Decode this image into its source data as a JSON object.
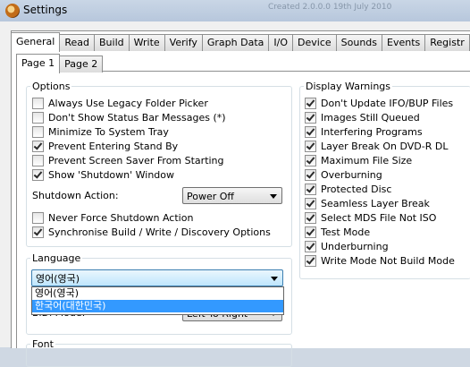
{
  "window": {
    "title": "Settings"
  },
  "tabs": [
    "General",
    "Read",
    "Build",
    "Write",
    "Verify",
    "Graph Data",
    "I/O",
    "Device",
    "Sounds",
    "Events",
    "Registr"
  ],
  "subtabs": [
    "Page 1",
    "Page 2"
  ],
  "options": {
    "legend": "Options",
    "items": [
      {
        "label": "Always Use Legacy Folder Picker",
        "checked": false
      },
      {
        "label": "Don't Show Status Bar Messages (*)",
        "checked": false
      },
      {
        "label": "Minimize To System Tray",
        "checked": false
      },
      {
        "label": "Prevent Entering Stand By",
        "checked": true
      },
      {
        "label": "Prevent Screen Saver From Starting",
        "checked": false
      },
      {
        "label": "Show 'Shutdown' Window",
        "checked": true
      }
    ],
    "shutdown_label": "Shutdown Action:",
    "shutdown_value": "Power Off",
    "items2": [
      {
        "label": "Never Force Shutdown Action",
        "checked": false
      },
      {
        "label": "Synchronise Build / Write / Discovery Options",
        "checked": true
      }
    ]
  },
  "display_warnings": {
    "legend": "Display Warnings",
    "items": [
      {
        "label": "Don't Update IFO/BUP Files",
        "checked": true
      },
      {
        "label": "Images Still Queued",
        "checked": true
      },
      {
        "label": "Interfering Programs",
        "checked": true
      },
      {
        "label": "Layer Break On DVD-R DL",
        "checked": true
      },
      {
        "label": "Maximum File Size",
        "checked": true
      },
      {
        "label": "Overburning",
        "checked": true
      },
      {
        "label": "Protected Disc",
        "checked": true
      },
      {
        "label": "Seamless Layer Break",
        "checked": true
      },
      {
        "label": "Select MDS File Not ISO",
        "checked": true
      },
      {
        "label": "Test Mode",
        "checked": true
      },
      {
        "label": "Underburning",
        "checked": true
      },
      {
        "label": "Write Mode Not Build Mode",
        "checked": true
      }
    ]
  },
  "language": {
    "legend": "Language",
    "selected": "영어(영국)",
    "options": [
      "영어(영국)",
      "한국어(대한민국)"
    ],
    "highlighted_index": 1,
    "bidi_label": "BiDi Mode:",
    "bidi_value": "Left To Right"
  },
  "font": {
    "legend": "Font"
  },
  "background_window": {
    "text": "Created 2.0.0.0 19th July 2010"
  }
}
